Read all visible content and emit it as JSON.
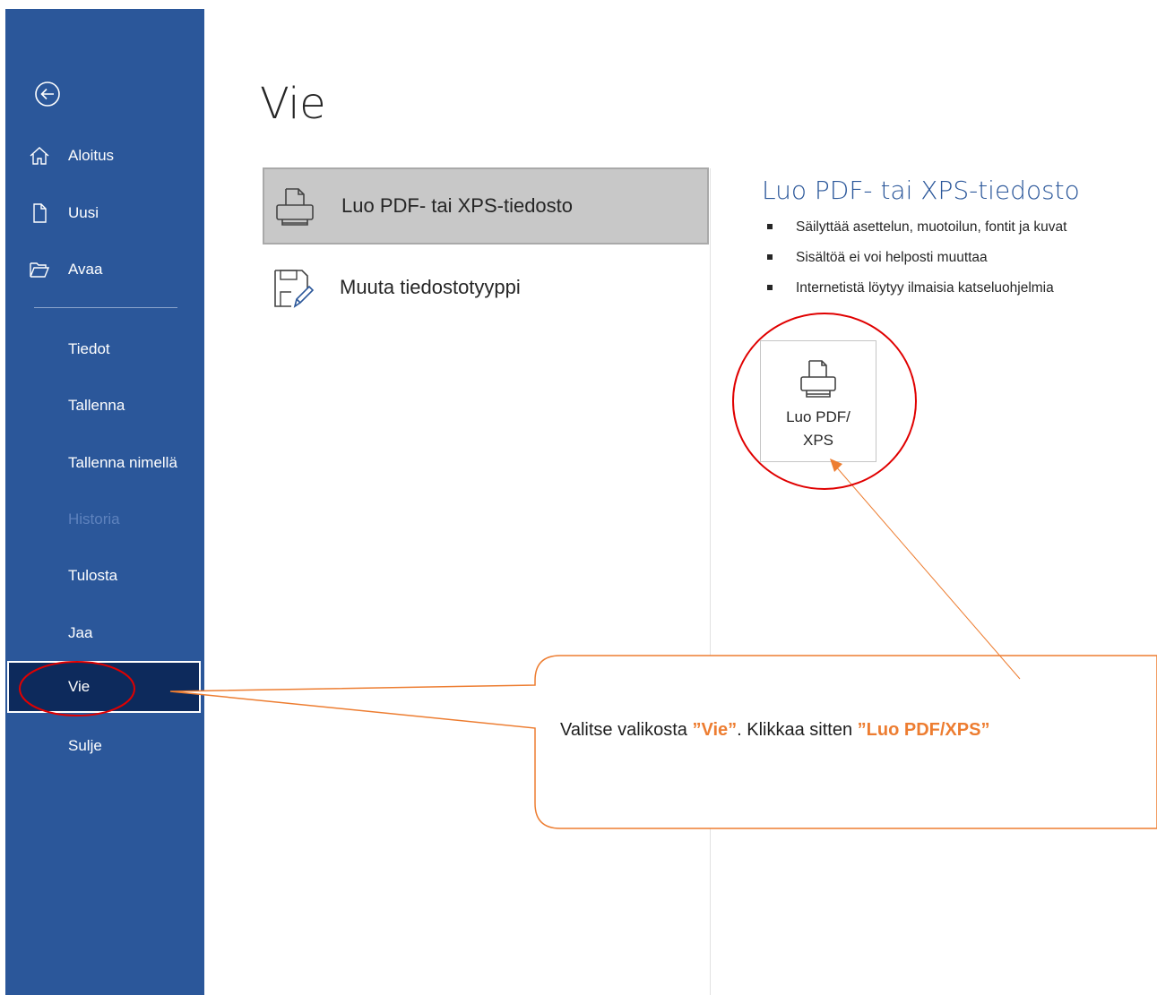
{
  "sidebar": {
    "items": [
      {
        "label": "Aloitus",
        "icon": "home-icon"
      },
      {
        "label": "Uusi",
        "icon": "new-document-icon"
      },
      {
        "label": "Avaa",
        "icon": "open-folder-icon"
      },
      {
        "label": "Tiedot"
      },
      {
        "label": "Tallenna"
      },
      {
        "label": "Tallenna nimellä"
      },
      {
        "label": "Historia",
        "disabled": true
      },
      {
        "label": "Tulosta"
      },
      {
        "label": "Jaa"
      },
      {
        "label": "Vie",
        "selected": true
      },
      {
        "label": "Sulje"
      }
    ],
    "background": "#2b579a",
    "selected_background": "#0d2a5c"
  },
  "main": {
    "title": "Vie",
    "options": [
      {
        "label": "Luo PDF- tai XPS-tiedosto",
        "icon": "pdf-printer-icon",
        "selected": true
      },
      {
        "label": "Muuta tiedostotyyppi",
        "icon": "change-filetype-icon"
      }
    ]
  },
  "detail": {
    "title": "Luo PDF- tai XPS-tiedosto",
    "bullets": [
      "Säilyttää asettelun, muotoilun, fontit ja kuvat",
      "Sisältöä ei voi helposti muuttaa",
      "Internetistä löytyy ilmaisia katseluohjelmia"
    ],
    "button_label": "Luo PDF/\nXPS",
    "accent": "#2b579a"
  },
  "annotation": {
    "text_before": "Valitse valikosta ",
    "highlight1": "”Vie”",
    "text_mid": ". Klikkaa sitten ",
    "highlight2": "”Luo PDF/XPS”",
    "highlight_color": "#ed7d31",
    "circle_color": "#e00000"
  }
}
